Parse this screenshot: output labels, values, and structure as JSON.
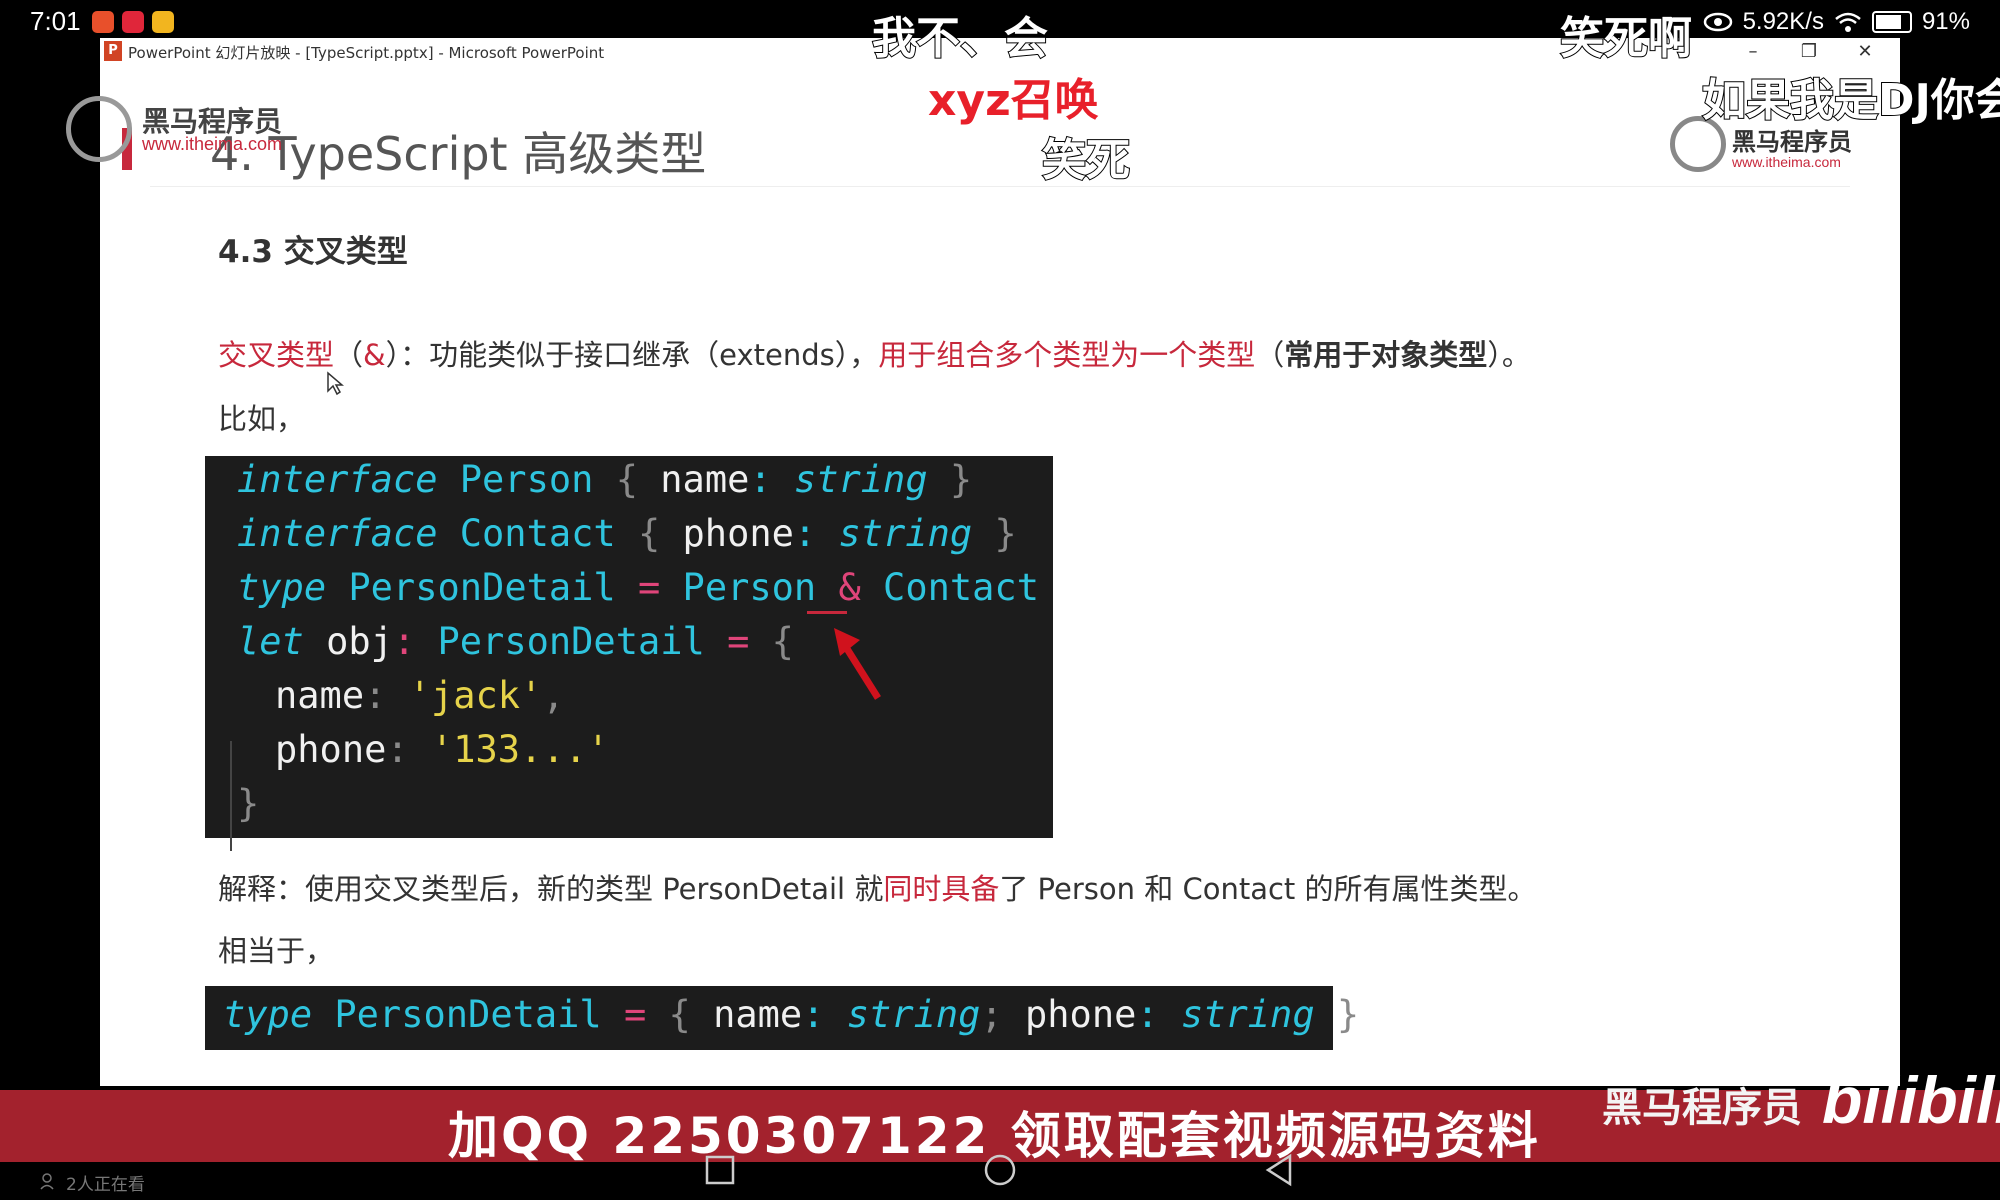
{
  "status_bar": {
    "time": "7:01",
    "network_speed": "5.92K/s",
    "battery": "91%",
    "battery_level": 0.91
  },
  "ppt_window": {
    "title": "PowerPoint 幻灯片放映 - [TypeScript.pptx] - Microsoft PowerPoint",
    "icon_letter": "P",
    "minimize": "–",
    "restore": "❐",
    "close": "✕"
  },
  "slide": {
    "title": "4. TypeScript 高级类型",
    "logo_left": {
      "name": "黑马程序员",
      "url": "www.itheima.com"
    },
    "logo_right": {
      "name": "黑马程序员",
      "url": "www.itheima.com"
    },
    "section_heading": "4.3 交叉类型",
    "definition": {
      "term": "交叉类型",
      "open": "（",
      "amp": "&",
      "close": "）：功能类似于接口继承（extends），",
      "highlight": "用于组合多个类型为一个类型",
      "paren_open": "（",
      "bold": "常用于对象类型",
      "paren_close": "）。"
    },
    "example_intro": "比如，",
    "code_block_1": {
      "line1": {
        "kw": "interface",
        "name": " Person ",
        "open": "{ ",
        "prop": "name",
        "colon": ": ",
        "type": "string",
        "close": " }"
      },
      "line2": {
        "kw": "interface",
        "name": " Contact ",
        "open": "{ ",
        "prop": "phone",
        "colon": ": ",
        "type": "string",
        "close": " }"
      },
      "line3": {
        "kw": "type",
        "name": " PersonDetail ",
        "eq": "= ",
        "a": "Person ",
        "amp": "&",
        "b": " Contact"
      },
      "line4": {
        "kw": "let",
        "var": " obj",
        "colon": ": ",
        "type": "PersonDetail ",
        "eq": "= ",
        "open": "{"
      },
      "line5": {
        "prop": "name",
        "colon": ": ",
        "value": "'jack'",
        "comma": ","
      },
      "line6": {
        "prop": "phone",
        "colon": ": ",
        "value": "'133...'"
      },
      "line7": {
        "close": "}"
      }
    },
    "explanation": {
      "prefix": "解释：使用交叉类型后，新的类型 PersonDetail 就",
      "highlight": "同时具备",
      "suffix": "了 Person 和 Contact 的所有属性类型。"
    },
    "equivalent_intro": "相当于，",
    "code_block_2": {
      "kw": "type",
      "name": " PersonDetail ",
      "eq": "= ",
      "open": "{ ",
      "p1": "name",
      "c1": ": ",
      "t1": "string",
      "sep": "; ",
      "p2": "phone",
      "c2": ": ",
      "t2": "string",
      "close": " }"
    }
  },
  "banner": {
    "text": "加QQ 2250307122  领取配套视频源码资料",
    "logo": "黑马程序员",
    "bilibili": "bilibili"
  },
  "nav": {
    "viewers": "2人正在看"
  },
  "danmaku": [
    "我不、会",
    "笑死啊",
    "xyz召唤",
    "如果我是DJ你会",
    "笑死"
  ],
  "colors": {
    "accent_red": "#c7283c",
    "code_bg": "#1c1c1c",
    "keyword_cyan": "#2fc4de",
    "string_yellow": "#e6d34a",
    "banner_red": "#a3222d"
  },
  "icons": [
    "eye-icon",
    "wifi-icon",
    "battery-icon",
    "cursor-icon",
    "arrow-icon",
    "recents-icon",
    "home-icon",
    "back-icon"
  ]
}
